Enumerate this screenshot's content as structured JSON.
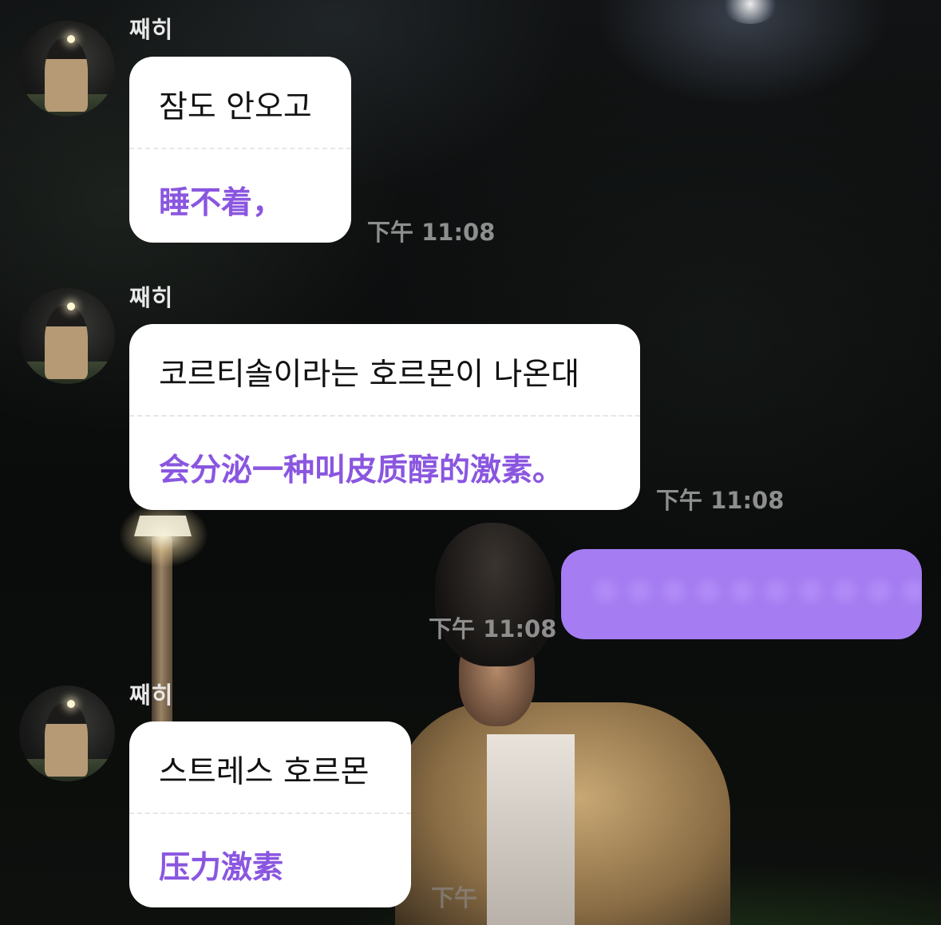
{
  "messages": [
    {
      "sender": "째히",
      "korean": "잠도 안오고",
      "chinese": "睡不着，",
      "time": "下午 11:08"
    },
    {
      "sender": "째히",
      "korean": "코르티솔이라는 호르몬이 나온대",
      "chinese": "会分泌一种叫皮质醇的激素。",
      "time": "下午 11:08"
    },
    {
      "own_time": "下午 11:08"
    },
    {
      "sender": "째히",
      "korean": "스트레스 호르몬",
      "chinese": "压力激素",
      "time": "下午"
    }
  ],
  "colors": {
    "bubble_incoming": "#ffffff",
    "bubble_outgoing": "#a57cf1",
    "translation_text": "#8a56e0",
    "timestamp": "#8e8e8e"
  },
  "icons": {
    "avatar": "profile-photo"
  }
}
